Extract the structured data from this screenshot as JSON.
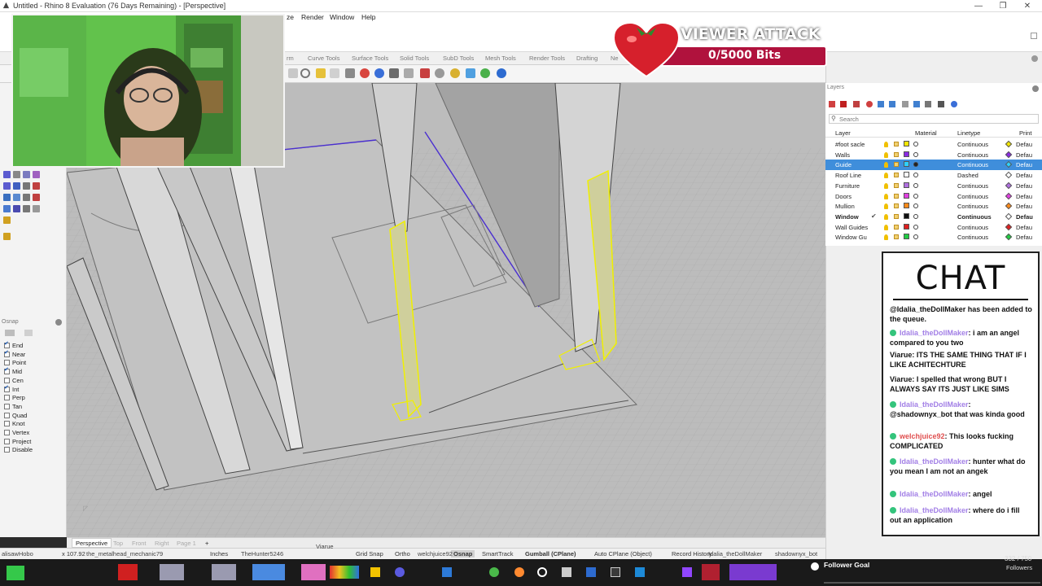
{
  "window": {
    "title": "Untitled - Rhino 8 Evaluation (76 Days Remaining) - [Perspective]",
    "buttons": [
      "—",
      "❐",
      "✕"
    ]
  },
  "menubar": {
    "items": [
      "ze",
      "Render",
      "Window",
      "Help"
    ]
  },
  "tabs": [
    "rm",
    "Curve Tools",
    "Surface Tools",
    "Solid Tools",
    "SubD Tools",
    "Mesh Tools",
    "Render Tools",
    "Drafting",
    "Ne"
  ],
  "viewer_attack": {
    "title": "VIEWER ATTACK",
    "progress": "0/5000 Bits",
    "accent": "#b0123d"
  },
  "layers_panel": {
    "title": "Layers",
    "search_placeholder": "Search",
    "columns": [
      "Layer",
      "Material",
      "Linetype",
      "Print"
    ],
    "rows": [
      {
        "name": "#foot sacle",
        "color": "#f2e600",
        "linetype": "Continuous",
        "print_color": "#f2e600",
        "print": "Defau"
      },
      {
        "name": "Walls",
        "color": "#8a2be2",
        "linetype": "Continuous",
        "print_color": "#8a2be2",
        "print": "Defau"
      },
      {
        "name": "Guide",
        "color": "#2ed0ff",
        "linetype": "Continuous",
        "print_color": "#2ed0ff",
        "print": "Defau",
        "selected": true
      },
      {
        "name": "Roof Line",
        "color": "#ffffff",
        "linetype": "Dashed",
        "print_color": "#ffffff",
        "print": "Defau"
      },
      {
        "name": "Furniture",
        "color": "#b070e0",
        "linetype": "Continuous",
        "print_color": "#b070e0",
        "print": "Defau"
      },
      {
        "name": "Doors",
        "color": "#e040e0",
        "linetype": "Continuous",
        "print_color": "#e040e0",
        "print": "Defau"
      },
      {
        "name": "Mullion",
        "color": "#ff8a1a",
        "linetype": "Continuous",
        "print_color": "#ff8a1a",
        "print": "Defau"
      },
      {
        "name": "Window",
        "color": "#111111",
        "linetype": "Continuous",
        "print_color": "#ffffff",
        "print": "Defau",
        "current": true
      },
      {
        "name": "Wall Guides",
        "color": "#e02020",
        "linetype": "Continuous",
        "print_color": "#e02020",
        "print": "Defau"
      },
      {
        "name": "Window Gu",
        "color": "#22cc44",
        "linetype": "Continuous",
        "print_color": "#22cc44",
        "print": "Defau"
      }
    ]
  },
  "osnap": {
    "title": "Osnap",
    "items": [
      {
        "label": "End",
        "checked": true
      },
      {
        "label": "Near",
        "checked": true
      },
      {
        "label": "Point",
        "checked": false
      },
      {
        "label": "Mid",
        "checked": true
      },
      {
        "label": "Cen",
        "checked": false
      },
      {
        "label": "Int",
        "checked": true
      },
      {
        "label": "Perp",
        "checked": false
      },
      {
        "label": "Tan",
        "checked": false
      },
      {
        "label": "Quad",
        "checked": false
      },
      {
        "label": "Knot",
        "checked": false
      },
      {
        "label": "Vertex",
        "checked": false
      },
      {
        "label": "Project",
        "checked": false
      },
      {
        "label": "Disable",
        "checked": false
      }
    ]
  },
  "viewport_tabs": [
    "Perspective",
    "Top",
    "Front",
    "Right",
    "Page 1",
    "+"
  ],
  "statusbar": {
    "coords": "x 107.92",
    "units": "Inches",
    "items": [
      "Grid Snap",
      "Ortho",
      "Osnap",
      "SmartTrack",
      "Gumball (CPlane)",
      "Auto CPlane (Object)",
      "Record History"
    ],
    "overlay_names": [
      "alisawHobo",
      "the_metalhead_mechanic79",
      "TheHunter5246",
      "Viarue",
      "welchjuice92",
      "Idalia_theDollMaker",
      "shadownyx_bot"
    ]
  },
  "chat": {
    "title": "CHAT",
    "messages": [
      {
        "name": "",
        "text": "@Idalia_theDollMaker has been added to the queue."
      },
      {
        "name": "Idalia_theDollMaker",
        "text": "i am an angel compared to you two",
        "badge": true,
        "name_color": "purple"
      },
      {
        "name": "Viarue",
        "text": "ITS THE SAME THING THAT IF I LIKE ACHITECHTURE",
        "badge": false,
        "name_color": "plain"
      },
      {
        "name": "Viarue",
        "text": "I spelled that wrong BUT I ALWAYS SAY ITS JUST LIKE SIMS",
        "badge": false,
        "name_color": "plain"
      },
      {
        "name": "Idalia_theDollMaker",
        "text": "@shadownyx_bot that was kinda good",
        "badge": true,
        "name_color": "purple"
      },
      {
        "name": "welchjuice92",
        "text": "This looks fucking COMPLICATED",
        "badge": true,
        "name_color": "red"
      },
      {
        "name": "Idalia_theDollMaker",
        "text": "hunter what do you mean I am not an angek",
        "badge": true,
        "name_color": "purple"
      },
      {
        "name": "Idalia_theDollMaker",
        "text": "angel",
        "badge": true,
        "name_color": "purple"
      },
      {
        "name": "Idalia_theDollMaker",
        "text": "where do i fill out an application",
        "badge": true,
        "name_color": "purple"
      }
    ]
  },
  "follower_goal": {
    "label": "Follower Goal",
    "count": "332 / 750",
    "sub": "Followers"
  }
}
